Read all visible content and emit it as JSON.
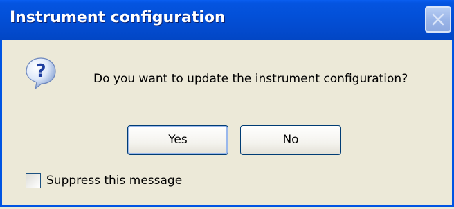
{
  "window": {
    "title": "Instrument configuration",
    "close_icon": "close-icon"
  },
  "dialog": {
    "icon": "question-icon",
    "message": "Do you want to update the instrument configuration?",
    "buttons": {
      "yes_label": "Yes",
      "no_label": "No"
    },
    "suppress": {
      "label": "Suppress this message",
      "checked": false
    }
  },
  "colors": {
    "titlebar": "#0350d8",
    "dialog_bg": "#ece9d8",
    "button_border": "#003c74"
  }
}
